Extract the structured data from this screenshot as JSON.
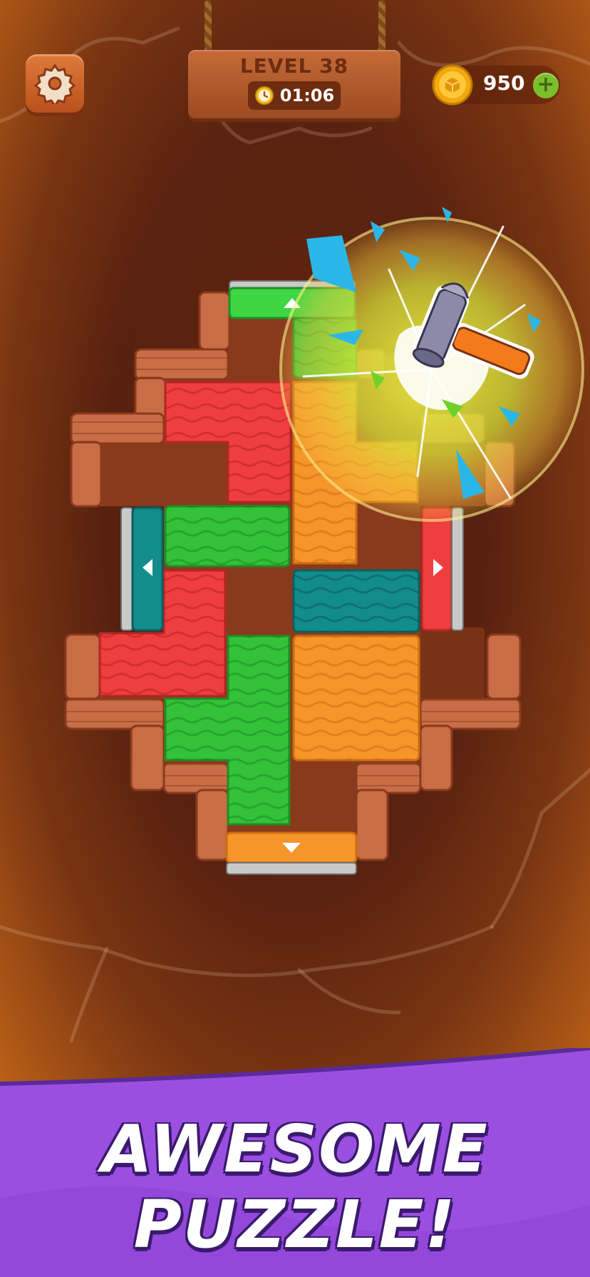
{
  "hud": {
    "level_label": "LEVEL 38",
    "timer": "01:06",
    "coins": "950",
    "add_coins": "+"
  },
  "icons": {
    "settings": "gear-icon",
    "timer": "clock-icon",
    "coin": "coin-icon",
    "booster": "hammer-icon",
    "exit_up": "arrow-up-icon",
    "exit_down": "arrow-down-icon",
    "exit_left": "arrow-left-icon",
    "exit_right": "arrow-right-icon"
  },
  "colors": {
    "red": "#ef3e3e",
    "green": "#33c23a",
    "orange": "#f5952a",
    "teal": "#138c8c",
    "wall": "#c86d45",
    "floor": "#8a3a1c",
    "banner": "#9b4fe0"
  },
  "banner": {
    "line1": "AWESOME",
    "line2": "PUZZLE!"
  }
}
